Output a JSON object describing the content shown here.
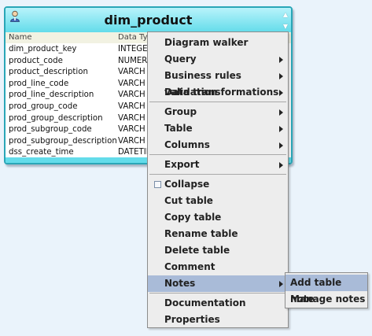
{
  "entity": {
    "title": "dim_product",
    "icon": "user-table-icon",
    "collapse_icon": "collapse-arrows-icon",
    "column_headers": [
      "Name",
      "Data Ty"
    ],
    "rows": [
      {
        "name": "dim_product_key",
        "type": "INTEGEF"
      },
      {
        "name": "product_code",
        "type": "NUMERI"
      },
      {
        "name": "product_description",
        "type": "VARCH"
      },
      {
        "name": "prod_line_code",
        "type": "VARCH"
      },
      {
        "name": "prod_line_description",
        "type": "VARCH"
      },
      {
        "name": "prod_group_code",
        "type": "VARCH"
      },
      {
        "name": "prod_group_description",
        "type": "VARCH"
      },
      {
        "name": "prod_subgroup_code",
        "type": "VARCH"
      },
      {
        "name": "prod_subgroup_description",
        "type": "VARCH"
      },
      {
        "name": "dss_create_time",
        "type": "DATETIN"
      }
    ]
  },
  "menu": {
    "items": [
      {
        "label": "Diagram walker",
        "submenu": false
      },
      {
        "label": "Query",
        "submenu": true
      },
      {
        "label": "Business rules validation",
        "submenu": true
      },
      {
        "label": "Data transformations",
        "submenu": true
      },
      {
        "label": "Group",
        "submenu": true
      },
      {
        "label": "Table",
        "submenu": true
      },
      {
        "label": "Columns",
        "submenu": true
      },
      {
        "label": "Export",
        "submenu": true
      },
      {
        "label": "Collapse",
        "submenu": false,
        "checkbox": true,
        "checked": false
      },
      {
        "label": "Cut table",
        "submenu": false
      },
      {
        "label": "Copy table",
        "submenu": false
      },
      {
        "label": "Rename table",
        "submenu": false
      },
      {
        "label": "Delete table",
        "submenu": false
      },
      {
        "label": "Comment",
        "submenu": false
      },
      {
        "label": "Notes",
        "submenu": true,
        "highlighted": true
      },
      {
        "label": "Documentation",
        "submenu": false
      },
      {
        "label": "Properties",
        "submenu": false
      }
    ]
  },
  "submenu": {
    "items": [
      {
        "label": "Add table note",
        "highlighted": true
      },
      {
        "label": "Manage notes",
        "highlighted": false
      }
    ]
  },
  "colors": {
    "background": "#eaf3fb",
    "entity_border": "#2aa6b7",
    "entity_header": "#63dcea",
    "menu_background": "#ededed",
    "menu_highlight": "#a9bbd8"
  }
}
